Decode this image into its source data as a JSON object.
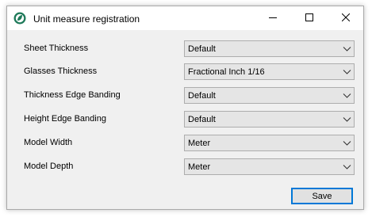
{
  "window": {
    "title": "Unit measure registration",
    "icon": "app-logo-icon"
  },
  "titlebar_buttons": {
    "minimize_icon": "minimize-icon",
    "maximize_icon": "maximize-icon",
    "close_icon": "close-icon"
  },
  "fields": [
    {
      "label": "Sheet Thickness",
      "value": "Default"
    },
    {
      "label": "Glasses Thickness",
      "value": "Fractional Inch 1/16"
    },
    {
      "label": "Thickness Edge Banding",
      "value": "Default"
    },
    {
      "label": "Height Edge Banding",
      "value": "Default"
    },
    {
      "label": "Model Width",
      "value": "Meter"
    },
    {
      "label": "Model Depth",
      "value": "Meter"
    }
  ],
  "actions": {
    "save_label": "Save"
  },
  "colors": {
    "accent": "#0078d7",
    "icon_green": "#1f7a5a"
  }
}
